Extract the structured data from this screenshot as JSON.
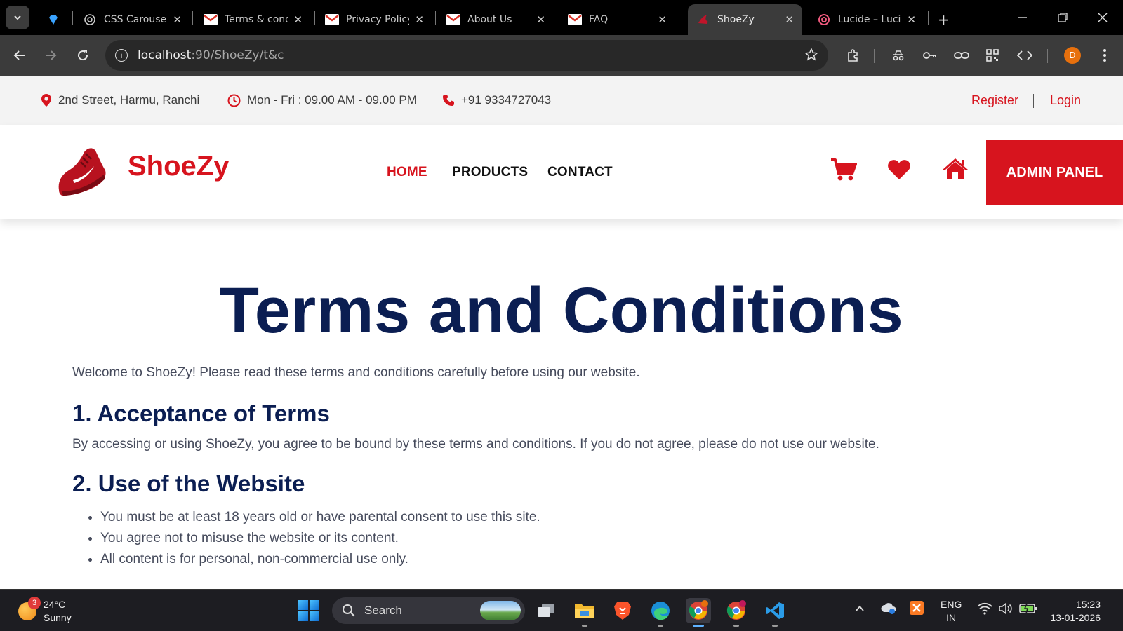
{
  "browser": {
    "tabs": [
      {
        "title": "",
        "icon": "gem-icon"
      },
      {
        "title": "CSS Carousel",
        "icon": "openai-icon"
      },
      {
        "title": "Terms & conditions",
        "icon": "gmail-icon"
      },
      {
        "title": "Privacy Policy",
        "icon": "gmail-icon"
      },
      {
        "title": "About Us",
        "icon": "gmail-icon"
      },
      {
        "title": "FAQ",
        "icon": "gmail-icon"
      },
      {
        "title": "ShoeZy",
        "icon": "shoe-icon",
        "active": true
      },
      {
        "title": "Lucide – Lucide",
        "icon": "lucide-icon"
      }
    ],
    "url_host": "localhost",
    "url_path": ":90/ShoeZy/t&c",
    "profile_initial": "D"
  },
  "site": {
    "topbar": {
      "address": "2nd Street, Harmu, Ranchi",
      "hours": "Mon - Fri : 09.00 AM - 09.00 PM",
      "phone": "+91 9334727043",
      "register": "Register",
      "login": "Login"
    },
    "brand": "ShoeZy",
    "nav": {
      "home": "HOME",
      "products": "PRODUCTS",
      "contact": "CONTACT"
    },
    "admin_button": "ADMIN PANEL",
    "accent_color": "#d7141e",
    "heading_color": "#0b1e52"
  },
  "page": {
    "title": "Terms and Conditions",
    "intro": "Welcome to ShoeZy! Please read these terms and conditions carefully before using our website.",
    "sections": [
      {
        "heading": "1. Acceptance of Terms",
        "text": "By accessing or using ShoeZy, you agree to be bound by these terms and conditions. If you do not agree, please do not use our website."
      },
      {
        "heading": "2. Use of the Website",
        "bullets": [
          "You must be at least 18 years old or have parental consent to use this site.",
          "You agree not to misuse the website or its content.",
          "All content is for personal, non-commercial use only."
        ]
      }
    ]
  },
  "taskbar": {
    "weather_temp": "24°C",
    "weather_desc": "Sunny",
    "weather_badge": "3",
    "search_label": "Search",
    "lang_top": "ENG",
    "lang_bottom": "IN",
    "time": "15:23",
    "date": "13-01-2026"
  }
}
